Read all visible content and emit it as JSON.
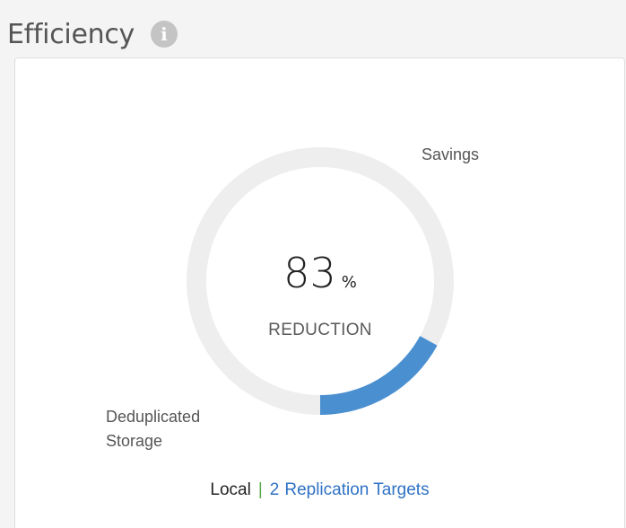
{
  "header": {
    "title": "Efficiency",
    "info_icon": "info-icon",
    "info_glyph": "i"
  },
  "chart_data": {
    "type": "pie",
    "style": "donut",
    "center_value": "83",
    "center_unit": "%",
    "center_label": "REDUCTION",
    "slices": [
      {
        "label": "Savings",
        "value": 83,
        "color": "#eeeeee"
      },
      {
        "label": "Deduplicated Storage",
        "value": 17,
        "color": "#4a8fd0"
      }
    ]
  },
  "labels": {
    "savings": "Savings",
    "dedup_line1": "Deduplicated",
    "dedup_line2": "Storage"
  },
  "footer": {
    "local": "Local",
    "separator": "|",
    "replication_count": "2",
    "replication_label": "Replication Targets"
  },
  "colors": {
    "accent": "#4a8fd0",
    "link": "#2f72c4",
    "separator": "#5aa84a",
    "track": "#eeeeee"
  }
}
